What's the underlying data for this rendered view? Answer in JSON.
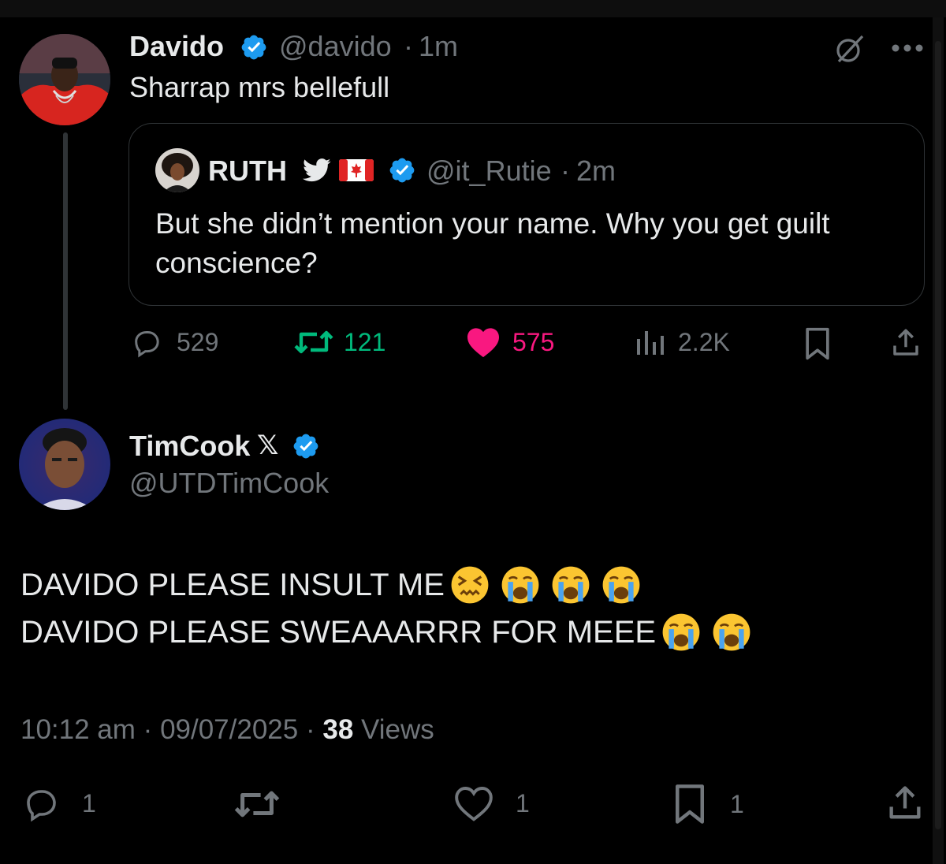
{
  "colors": {
    "background": "#000000",
    "text": "#e7e9ea",
    "muted": "#71767b",
    "verified": "#1d9bf0",
    "retweet": "#00ba7c",
    "like": "#f91880",
    "border": "#2f3336"
  },
  "parent_tweet": {
    "author_name": "Davido",
    "handle": "@davido",
    "time": "1m",
    "text": "Sharrap mrs bellefull",
    "icons": [
      "verified-badge-icon",
      "grok-icon",
      "more-icon"
    ],
    "quoted": {
      "author_name": "RUTH",
      "handle": "@it_Rutie",
      "time": "2m",
      "text_line1": "But she didn’t mention your name. Why you get guilt",
      "text_line2": "conscience?",
      "icons": [
        "bird-icon",
        "canada-flag-icon",
        "verified-badge-icon"
      ]
    },
    "actions": {
      "replies": "529",
      "retweets": "121",
      "likes": "575",
      "views": "2.2K"
    }
  },
  "main_tweet": {
    "author_name": "TimCook",
    "name_suffix": "𝕏",
    "handle": "@UTDTimCook",
    "text_line1": "DAVIDO PLEASE INSULT ME",
    "text_line2": "DAVIDO PLEASE SWEAAARRR FOR MEEE",
    "line1_emojis": [
      "confounded-face-icon",
      "crying-face-icon",
      "crying-face-icon",
      "crying-face-icon"
    ],
    "line2_emojis": [
      "crying-face-icon",
      "crying-face-icon"
    ],
    "timestamp": "10:12 am",
    "date": "09/07/2025",
    "views_count": "38",
    "views_label": "Views",
    "actions": {
      "replies": "1",
      "likes": "1",
      "bookmarks": "1"
    }
  }
}
